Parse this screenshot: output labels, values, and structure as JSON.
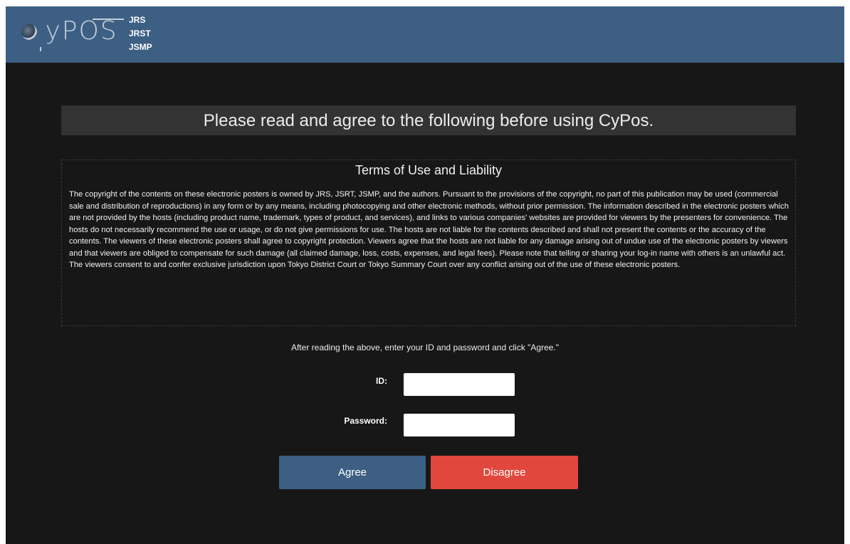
{
  "header": {
    "logo_text": "CyPOS",
    "orgs": [
      "JRS",
      "JRST",
      "JSMP"
    ],
    "colors": {
      "header_bg": "#3d5f84",
      "page_bg": "#171717"
    }
  },
  "notice": "Please read and agree to the following before using CyPos.",
  "terms": {
    "title": "Terms of Use and Liability",
    "body": "The copyright of the contents on these electronic posters is owned by JRS, JSRT, JSMP, and the authors. Pursuant to the provisions of the copyright, no part of this publication may be used (commercial sale and distribution of reproductions) in any form or by any means, including photocopying and other electronic methods, without prior permission. The information described in the electronic posters which are not provided by the hosts (including product name, trademark, types of product, and services), and links to various companies' websites are provided for viewers by the presenters for convenience. The hosts do not necessarily recommend the use or usage, or do not give permissions for use. The hosts are not liable for the contents described and shall not present the contents or the accuracy of the contents. The viewers of these electronic posters shall agree to copyright protection. Viewers agree that the hosts are not liable for any damage arising out of undue use of the electronic posters by viewers and that viewers are obliged to compensate for such damage (all claimed damage, loss, costs, expenses, and legal fees). Please note that telling or sharing your log-in name with others is an unlawful act. The viewers consent to and confer exclusive jurisdiction upon Tokyo District Court or Tokyo Summary Court over any conflict arising out of the use of these electronic posters."
  },
  "form": {
    "instruction": "After reading the above, enter your ID and password and click \"Agree.\"",
    "id_label": "ID:",
    "id_value": "",
    "password_label": "Password:",
    "password_value": "",
    "agree_label": "Agree",
    "disagree_label": "Disagree",
    "colors": {
      "agree": "#3d5f84",
      "disagree": "#e2473d"
    }
  }
}
